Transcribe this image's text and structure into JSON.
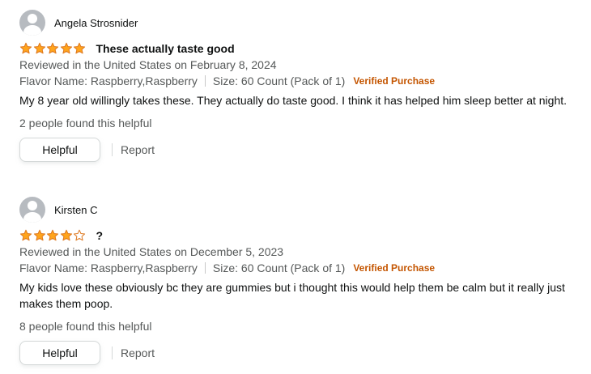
{
  "colors": {
    "star_fill": "#ffa41c",
    "star_stroke": "#de7921",
    "verified": "#c45500",
    "meta_text": "#565959"
  },
  "reviews": [
    {
      "author": "Angela Strosnider",
      "rating": 5,
      "title": "These actually taste good",
      "date": "Reviewed in the United States on February 8, 2024",
      "flavor": "Flavor Name: Raspberry,Raspberry",
      "size": "Size: 60 Count (Pack of 1)",
      "verified": "Verified Purchase",
      "body": "My 8 year old willingly takes these. They actually do taste good. I think it has helped him sleep better at night.",
      "helpful_count": "2 people found this helpful",
      "helpful_label": "Helpful",
      "report_label": "Report"
    },
    {
      "author": "Kirsten C",
      "rating": 4,
      "title": "?",
      "date": "Reviewed in the United States on December 5, 2023",
      "flavor": "Flavor Name: Raspberry,Raspberry",
      "size": "Size: 60 Count (Pack of 1)",
      "verified": "Verified Purchase",
      "body": "My kids love these obviously bc they are gummies but i thought this would help them be calm but it really just makes them poop.",
      "helpful_count": "8 people found this helpful",
      "helpful_label": "Helpful",
      "report_label": "Report"
    }
  ]
}
